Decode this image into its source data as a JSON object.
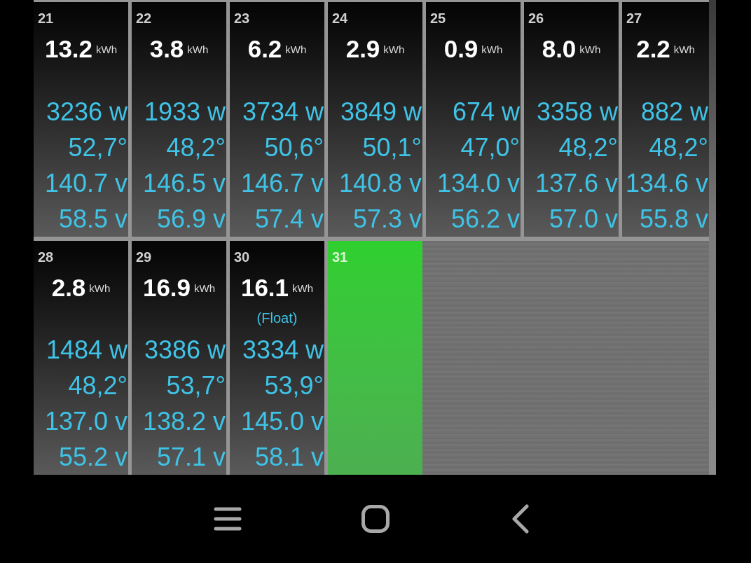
{
  "days": [
    {
      "day": "21",
      "energy": "13.2",
      "unit": "kWh",
      "readings": [
        "3236 w",
        "52,7°",
        "140.7 v",
        "58.5 v"
      ],
      "selected": false
    },
    {
      "day": "22",
      "energy": "3.8",
      "unit": "kWh",
      "readings": [
        "1933 w",
        "48,2°",
        "146.5 v",
        "56.9 v"
      ],
      "selected": false
    },
    {
      "day": "23",
      "energy": "6.2",
      "unit": "kWh",
      "readings": [
        "3734 w",
        "50,6°",
        "146.7 v",
        "57.4 v"
      ],
      "selected": false
    },
    {
      "day": "24",
      "energy": "2.9",
      "unit": "kWh",
      "readings": [
        "3849 w",
        "50,1°",
        "140.8 v",
        "57.3 v"
      ],
      "selected": false
    },
    {
      "day": "25",
      "energy": "0.9",
      "unit": "kWh",
      "readings": [
        "674 w",
        "47,0°",
        "134.0 v",
        "56.2 v"
      ],
      "selected": false
    },
    {
      "day": "26",
      "energy": "8.0",
      "unit": "kWh",
      "readings": [
        "3358 w",
        "48,2°",
        "137.6 v",
        "57.0 v"
      ],
      "selected": false
    },
    {
      "day": "27",
      "energy": "2.2",
      "unit": "kWh",
      "readings": [
        "882 w",
        "48,2°",
        "134.6 v",
        "55.8 v"
      ],
      "selected": false
    },
    {
      "day": "28",
      "energy": "2.8",
      "unit": "kWh",
      "readings": [
        "1484 w",
        "48,2°",
        "137.0 v",
        "55.2 v"
      ],
      "selected": false
    },
    {
      "day": "29",
      "energy": "16.9",
      "unit": "kWh",
      "readings": [
        "3386 w",
        "53,7°",
        "138.2 v",
        "57.1 v"
      ],
      "selected": false
    },
    {
      "day": "30",
      "energy": "16.1",
      "unit": "kWh",
      "status": "(Float)",
      "readings": [
        "3334 w",
        "53,9°",
        "145.0 v",
        "58.1 v"
      ],
      "selected": false
    },
    {
      "day": "31",
      "selected": true
    }
  ],
  "nav_bar": [
    {
      "kind": "menu"
    },
    {
      "kind": "home"
    },
    {
      "kind": "back"
    }
  ]
}
